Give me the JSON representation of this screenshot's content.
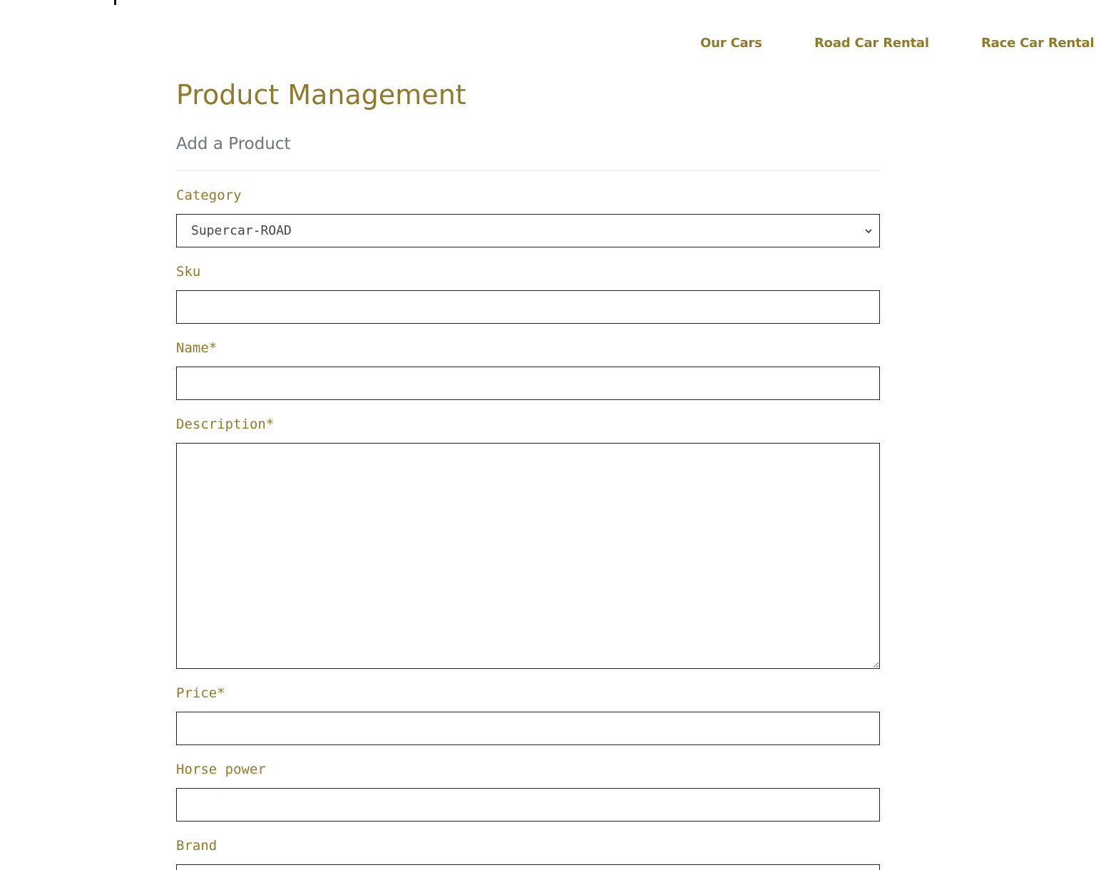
{
  "nav": {
    "items": [
      {
        "label": "Our Cars"
      },
      {
        "label": "Road Car Rental"
      },
      {
        "label": "Race Car Rental"
      }
    ]
  },
  "page": {
    "title": "Product Management",
    "section_title": "Add a Product"
  },
  "form": {
    "category": {
      "label": "Category",
      "selected": "Supercar-ROAD"
    },
    "sku": {
      "label": "Sku",
      "value": ""
    },
    "name": {
      "label": "Name*",
      "value": ""
    },
    "description": {
      "label": "Description*",
      "value": ""
    },
    "price": {
      "label": "Price*",
      "value": ""
    },
    "horse_power": {
      "label": "Horse power",
      "value": ""
    },
    "brand": {
      "label": "Brand",
      "value": ""
    }
  },
  "colors": {
    "accent": "#8f7a2a",
    "muted": "#6c757d",
    "border": "#222222"
  }
}
